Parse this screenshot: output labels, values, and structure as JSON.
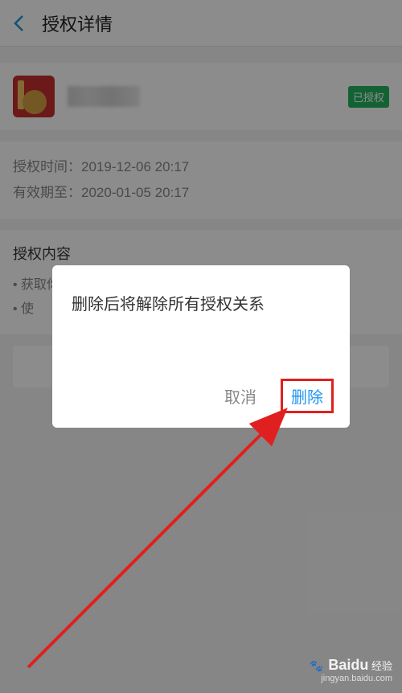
{
  "header": {
    "title": "授权详情"
  },
  "app": {
    "status_badge": "已授权"
  },
  "time": {
    "auth_time_label": "授权时间：",
    "auth_time_value": "2019-12-06 20:17",
    "expire_label": "有效期至：",
    "expire_value": "2020-01-05 20:17"
  },
  "content": {
    "title": "授权内容",
    "items": [
      "获取你的公开信息(昵称、头像、性别等)",
      "使"
    ]
  },
  "dialog": {
    "message": "删除后将解除所有授权关系",
    "cancel": "取消",
    "delete": "删除"
  },
  "watermark": {
    "brand": "Baidu",
    "suffix": "经验",
    "url": "jingyan.baidu.com"
  }
}
